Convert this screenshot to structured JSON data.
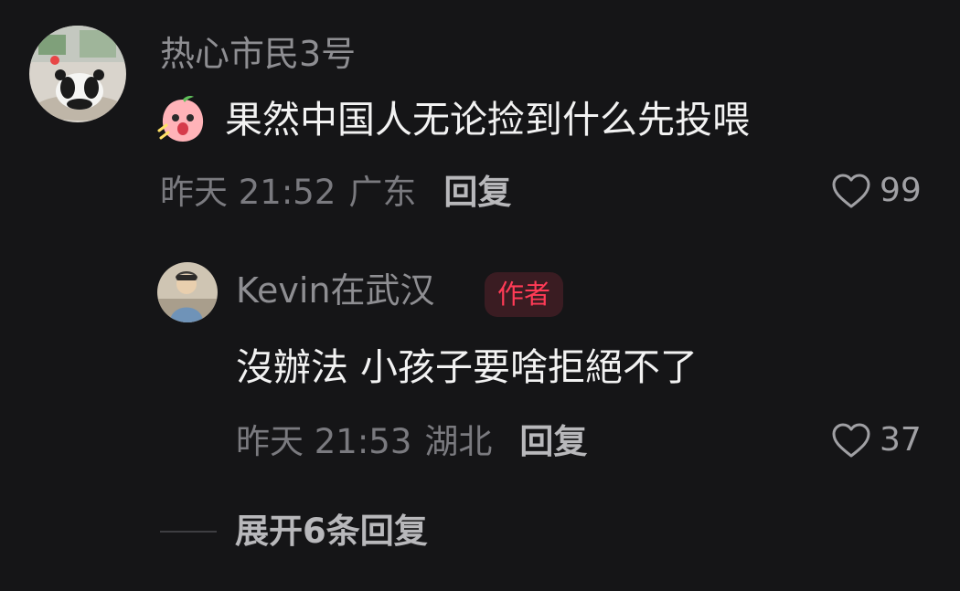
{
  "comment": {
    "username": "热心市民3号",
    "sticker": "surprised-peach-sticker",
    "text": "果然中国人无论捡到什么先投喂",
    "time": "昨天 21:52",
    "location": "广东",
    "reply_label": "回复",
    "likes": "99"
  },
  "reply": {
    "username": "Kevin在武汉",
    "badge": "作者",
    "text": "沒辦法 小孩子要啥拒絕不了",
    "time": "昨天 21:53",
    "location": "湖北",
    "reply_label": "回复",
    "likes": "37"
  },
  "expand": {
    "label": "展开6条回复"
  },
  "colors": {
    "background": "#151517",
    "author_badge_bg": "#3a1c22",
    "author_badge_text": "#ff3b56",
    "text_primary": "#f2f2f2",
    "text_secondary": "#8e8e92"
  }
}
